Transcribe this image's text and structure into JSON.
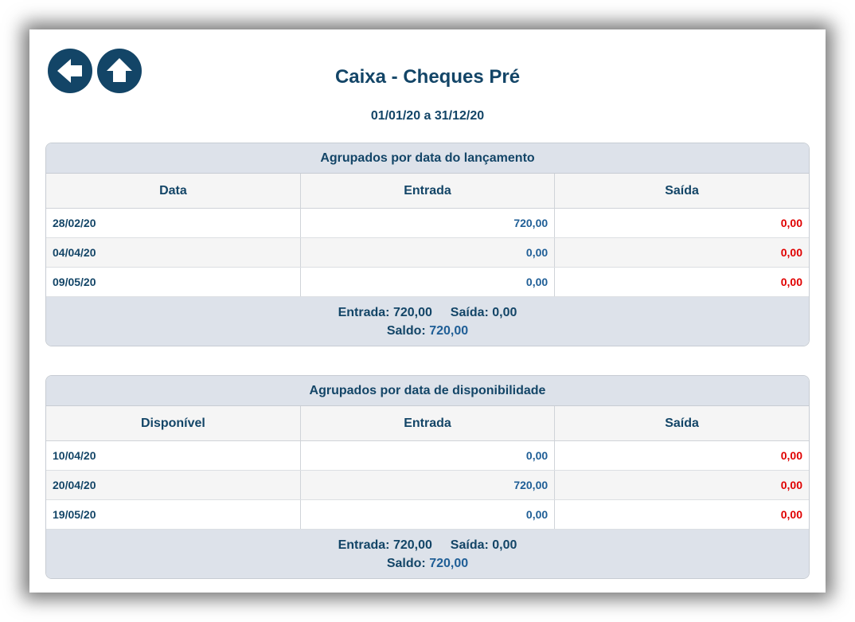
{
  "nav": {
    "back_icon": "arrow-left-icon",
    "up_icon": "arrow-up-icon",
    "button_color": "#134567"
  },
  "header": {
    "title": "Caixa - Cheques Pré",
    "period": "01/01/20 a 31/12/20"
  },
  "colors": {
    "entrada": "#1f5e96",
    "saida": "#e00000",
    "text": "#134567"
  },
  "groups": [
    {
      "title": "Agrupados por data do lançamento",
      "columns": [
        "Data",
        "Entrada",
        "Saída"
      ],
      "rows": [
        {
          "date": "28/02/20",
          "entrada": "720,00",
          "saida": "0,00"
        },
        {
          "date": "04/04/20",
          "entrada": "0,00",
          "saida": "0,00"
        },
        {
          "date": "09/05/20",
          "entrada": "0,00",
          "saida": "0,00"
        }
      ],
      "summary": {
        "entrada_label": "Entrada:",
        "entrada_value": "720,00",
        "saida_label": "Saída:",
        "saida_value": "0,00",
        "saldo_label": "Saldo:",
        "saldo_value": "720,00"
      }
    },
    {
      "title": "Agrupados por data de disponibilidade",
      "columns": [
        "Disponível",
        "Entrada",
        "Saída"
      ],
      "rows": [
        {
          "date": "10/04/20",
          "entrada": "0,00",
          "saida": "0,00"
        },
        {
          "date": "20/04/20",
          "entrada": "720,00",
          "saida": "0,00"
        },
        {
          "date": "19/05/20",
          "entrada": "0,00",
          "saida": "0,00"
        }
      ],
      "summary": {
        "entrada_label": "Entrada:",
        "entrada_value": "720,00",
        "saida_label": "Saída:",
        "saida_value": "0,00",
        "saldo_label": "Saldo:",
        "saldo_value": "720,00"
      }
    }
  ]
}
